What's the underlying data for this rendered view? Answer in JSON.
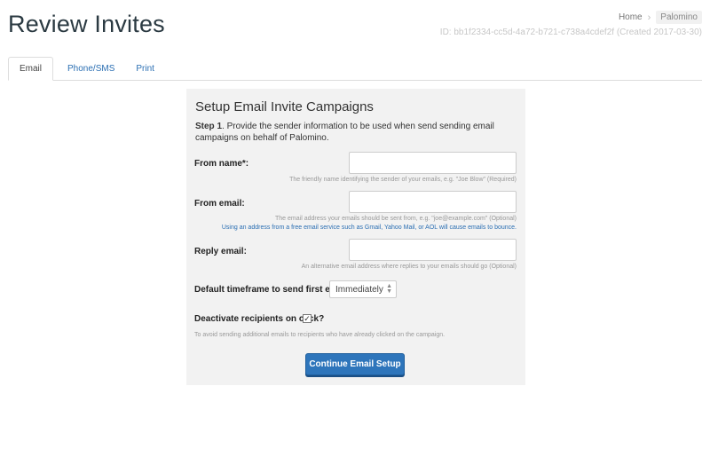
{
  "header": {
    "title": "Review Invites",
    "breadcrumb": {
      "home": "Home",
      "separator": "›",
      "current": "Palomino"
    },
    "id_text": "ID: bb1f2334-cc5d-4a72-b721-c738a4cdef2f (Created 2017-03-30)"
  },
  "tabs": [
    {
      "label": "Email",
      "active": true
    },
    {
      "label": "Phone/SMS",
      "active": false
    },
    {
      "label": "Print",
      "active": false
    }
  ],
  "form": {
    "title": "Setup Email Invite Campaigns",
    "step_label": "Step 1",
    "step_text": ". Provide the sender information to be used when send sending email campaigns on behalf of Palomino.",
    "from_name": {
      "label": "From name*:",
      "value": "",
      "help": "The friendly name identifying the sender of your emails, e.g. \"Joe Blow\" (Required)"
    },
    "from_email": {
      "label": "From email:",
      "value": "",
      "help": "The email address your emails should be sent from, e.g. \"joe@example.com\" (Optional)",
      "warning": "Using an address from a free email service such as Gmail, Yahoo Mail, or AOL will cause emails to bounce."
    },
    "reply_email": {
      "label": "Reply email:",
      "value": "",
      "help": "An alternative email address where replies to your emails should go (Optional)"
    },
    "timeframe": {
      "label": "Default timeframe to send first email:",
      "selected": "Immediately"
    },
    "deactivate": {
      "label": "Deactivate recipients on click?",
      "checked": true,
      "check_glyph": "✓",
      "help": "To avoid sending additional emails to recipients who have already clicked on the campaign."
    },
    "submit_label": "Continue Email Setup"
  },
  "colors": {
    "accent": "#2e75bb",
    "link": "#2b6fb3",
    "panel_bg": "#f2f2f2"
  }
}
